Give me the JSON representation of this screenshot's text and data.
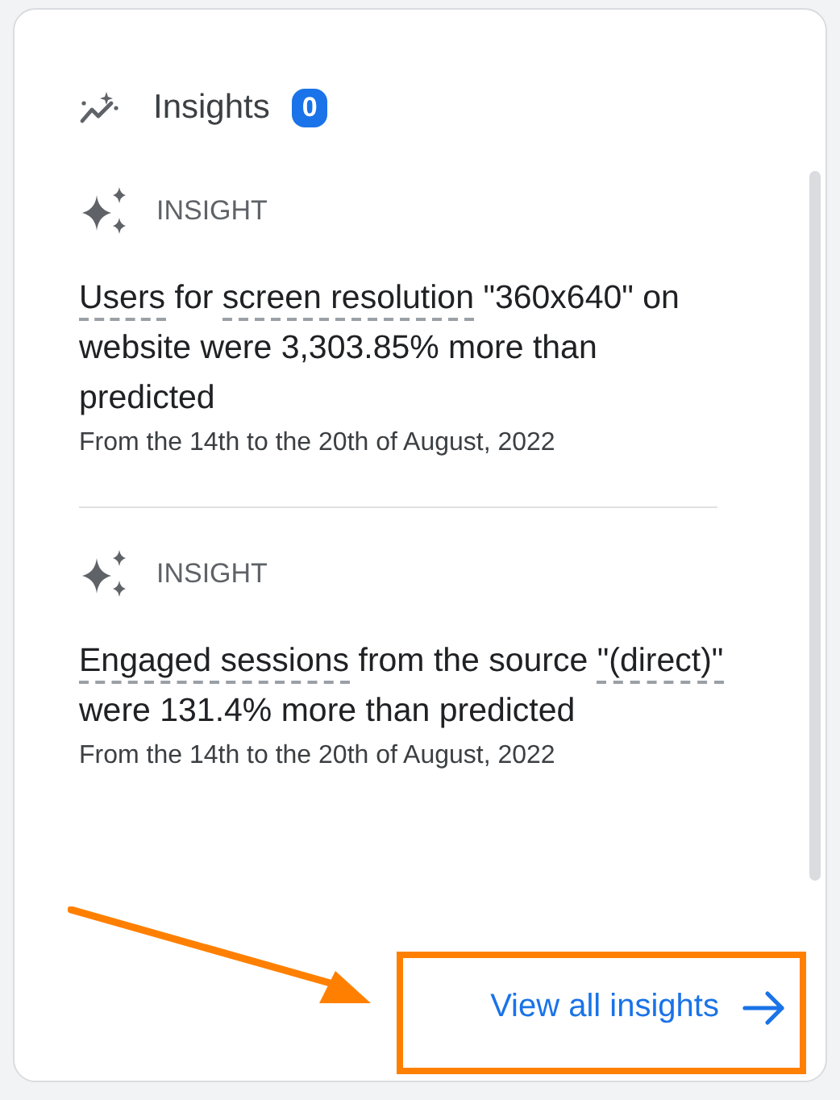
{
  "header": {
    "title": "Insights",
    "badge": "0"
  },
  "insights": [
    {
      "label": "INSIGHT",
      "segments": [
        {
          "text": "Users",
          "underlined": true
        },
        {
          "text": " for ",
          "underlined": false
        },
        {
          "text": "screen resolution",
          "underlined": true
        },
        {
          "text": " \"360x640\" on website were 3,303.85% more than predicted",
          "underlined": false
        }
      ],
      "date": "From the 14th to the 20th of August, 2022"
    },
    {
      "label": "INSIGHT",
      "segments": [
        {
          "text": "Engaged sessions",
          "underlined": true
        },
        {
          "text": " from the source ",
          "underlined": false
        },
        {
          "text": "\"(direct)\"",
          "underlined": true
        },
        {
          "text": " were 131.4% more than predicted",
          "underlined": false
        }
      ],
      "date": "From the 14th to the 20th of August, 2022"
    }
  ],
  "view_all": {
    "label": "View all insights",
    "highlighted": true
  }
}
